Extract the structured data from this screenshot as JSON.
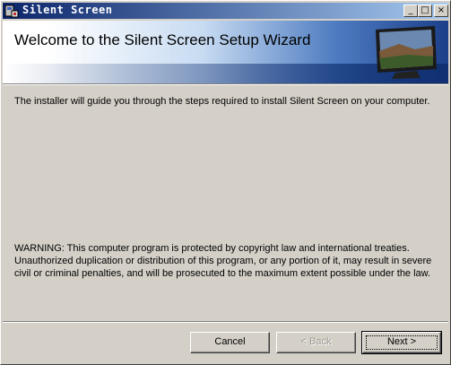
{
  "window": {
    "title": "Silent Screen",
    "controls": {
      "minimize": "_",
      "maximize": "□",
      "close": "×"
    }
  },
  "banner": {
    "title": "Welcome to the Silent Screen Setup Wizard",
    "image_icon": "monitor-icon"
  },
  "body": {
    "intro": "The installer will guide you through the steps required to install Silent Screen on your computer.",
    "warning": "WARNING: This computer program is protected by copyright law and international treaties. Unauthorized duplication or distribution of this program, or any portion of it, may result in severe civil or criminal penalties, and will be prosecuted to the maximum extent possible under the law."
  },
  "buttons": {
    "cancel": "Cancel",
    "back": "< Back",
    "next": "Next >"
  },
  "colors": {
    "titlebar_start": "#0a246a",
    "titlebar_end": "#a6caf0",
    "dialog_bg": "#d4d0c8"
  }
}
